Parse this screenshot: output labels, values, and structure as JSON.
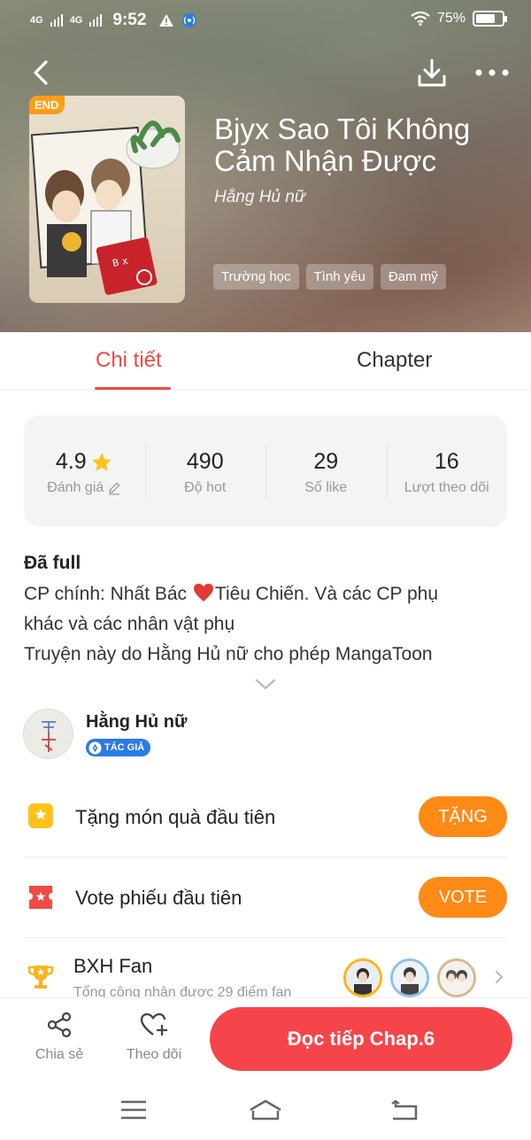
{
  "status_bar": {
    "network_1": "4G",
    "network_2": "4G",
    "time": "9:52",
    "battery": "75%",
    "battery_level": 0.75
  },
  "book": {
    "badge": "END",
    "title": "Bjyx Sao Tôi Không Cảm Nhận Được",
    "author": "Hằng Hủ nữ",
    "tags": [
      "Trường học",
      "Tình yêu",
      "Đam mỹ"
    ]
  },
  "tabs": [
    {
      "label": "Chi tiết",
      "active": true
    },
    {
      "label": "Chapter",
      "active": false
    }
  ],
  "stats": [
    {
      "value": "4.9",
      "label": "Đánh giá"
    },
    {
      "value": "490",
      "label": "Độ hot"
    },
    {
      "value": "29",
      "label": "Số like"
    },
    {
      "value": "16",
      "label": "Lượt theo dõi"
    }
  ],
  "description": {
    "status": "Đã full",
    "line1_before": "CP chính: Nhất Bác ",
    "line1_after": "Tiêu Chiến. Và các CP phụ",
    "line2": "khác và các nhân vật phụ",
    "line3": "Truyện này do Hằng Hủ nữ cho phép MangaToon"
  },
  "author_section": {
    "name": "Hằng Hủ nữ",
    "badge": "TÁC GIẢ"
  },
  "actions": [
    {
      "label": "Tặng món quà đầu tiên",
      "button": "TẶNG",
      "icon": "gift-icon"
    },
    {
      "label": "Vote phiếu đầu tiên",
      "button": "VOTE",
      "icon": "ticket-icon"
    }
  ],
  "fan_ranking": {
    "title": "BXH Fan",
    "subtitle": "Tổng cộng nhận được 29 điểm fan"
  },
  "bottom_bar": {
    "share": "Chia sẻ",
    "follow": "Theo dõi",
    "read": "Đọc tiếp Chap.6"
  },
  "colors": {
    "accent": "#ef4a45",
    "orange": "#ff8a16",
    "read_button": "#f5454a",
    "author_badge": "#2b7be6"
  }
}
